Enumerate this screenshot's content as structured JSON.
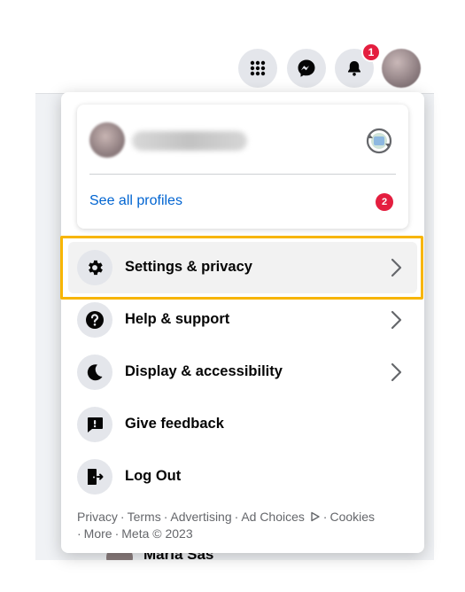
{
  "topbar": {
    "icons": [
      "apps-grid-icon",
      "messenger-icon",
      "bell-icon",
      "avatar"
    ],
    "notification_count": "1"
  },
  "background": {
    "partial_name": "Maria Sas"
  },
  "profile_card": {
    "see_all_label": "See all profiles",
    "see_all_badge": "2"
  },
  "menu": {
    "items": [
      {
        "label": "Settings & privacy",
        "icon": "gear-icon",
        "has_chevron": true,
        "highlighted": true
      },
      {
        "label": "Help & support",
        "icon": "question-icon",
        "has_chevron": true
      },
      {
        "label": "Display & accessibility",
        "icon": "moon-icon",
        "has_chevron": true
      },
      {
        "label": "Give feedback",
        "icon": "feedback-icon",
        "has_chevron": false
      },
      {
        "label": "Log Out",
        "icon": "logout-icon",
        "has_chevron": false
      }
    ]
  },
  "footer": {
    "privacy": "Privacy",
    "terms": "Terms",
    "advertising": "Advertising",
    "ad_choices": "Ad Choices",
    "cookies": "Cookies",
    "more": "More",
    "copyright": "Meta © 2023"
  },
  "colors": {
    "accent_link": "#0064d1",
    "badge": "#e41e3f",
    "highlight_border": "#f7b500"
  }
}
